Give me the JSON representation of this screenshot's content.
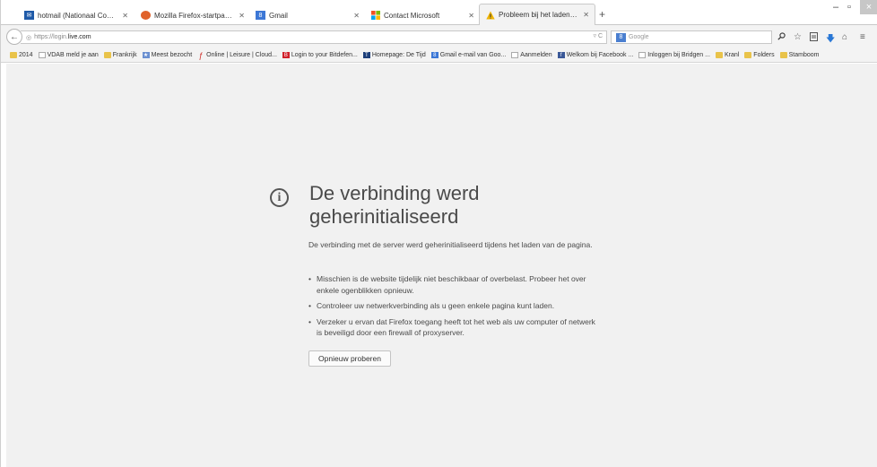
{
  "tabs": [
    {
      "title": "hotmail (Nationaal Compu...",
      "icon": "hotmail-favicon",
      "color": "#1f5aa8"
    },
    {
      "title": "Mozilla Firefox-startpagina",
      "icon": "firefox-favicon",
      "color": "#e0622b"
    },
    {
      "title": "Gmail",
      "icon": "gmail-favicon",
      "color": "#3c77d6"
    },
    {
      "title": "Contact Microsoft",
      "icon": "microsoft-favicon",
      "color": "#f25022"
    },
    {
      "title": "Probleem bij het laden van...",
      "icon": "warning-favicon",
      "color": "#e0a800"
    }
  ],
  "new_tab_symbol": "+",
  "window_controls": {
    "minimize": "–",
    "maximize": "▫",
    "close": "×"
  },
  "nav": {
    "back_symbol": "←",
    "url_prefix": "https://login.",
    "url_host": "live.com",
    "url_reload": "▿ C",
    "search_engine_icon": "google-search-icon",
    "search_placeholder": "Google"
  },
  "bookmarks": [
    {
      "label": "2014",
      "icon": "folder-icon"
    },
    {
      "label": "VDAB meld je aan",
      "icon": "page-icon"
    },
    {
      "label": "Frankrijk",
      "icon": "folder-icon"
    },
    {
      "label": "Meest bezocht",
      "icon": "star-icon"
    },
    {
      "label": "Online | Leisure | Cloud...",
      "icon": "pen-icon"
    },
    {
      "label": "Login to your Bitdefen...",
      "icon": "bitdefender-icon"
    },
    {
      "label": "Homepage: De Tijd",
      "icon": "tijd-icon"
    },
    {
      "label": "Gmail e-mail van Goo...",
      "icon": "gmail-icon"
    },
    {
      "label": "Aanmelden",
      "icon": "page-icon"
    },
    {
      "label": "Welkom bij Facebook ...",
      "icon": "facebook-icon"
    },
    {
      "label": "Inloggen bij Bridgen ...",
      "icon": "page-icon"
    },
    {
      "label": "Kranl",
      "icon": "folder-icon"
    },
    {
      "label": "Folders",
      "icon": "folder-icon"
    },
    {
      "label": "Stamboom",
      "icon": "folder-icon"
    }
  ],
  "error": {
    "icon": "info-icon",
    "title_line1": "De verbinding werd",
    "title_line2": "geherinitialiseerd",
    "description": "De verbinding met de server werd geherinitialiseerd tijdens het laden van de pagina.",
    "suggestions": [
      "Misschien is de website tijdelijk niet beschikbaar of overbelast. Probeer het over enkele ogenblikken opnieuw.",
      "Controleer uw netwerkverbinding als u geen enkele pagina kunt laden.",
      "Verzeker u ervan dat Firefox toegang heeft tot het web als uw computer of netwerk is beveiligd door een firewall of proxyserver."
    ],
    "retry_label": "Opnieuw proberen"
  }
}
